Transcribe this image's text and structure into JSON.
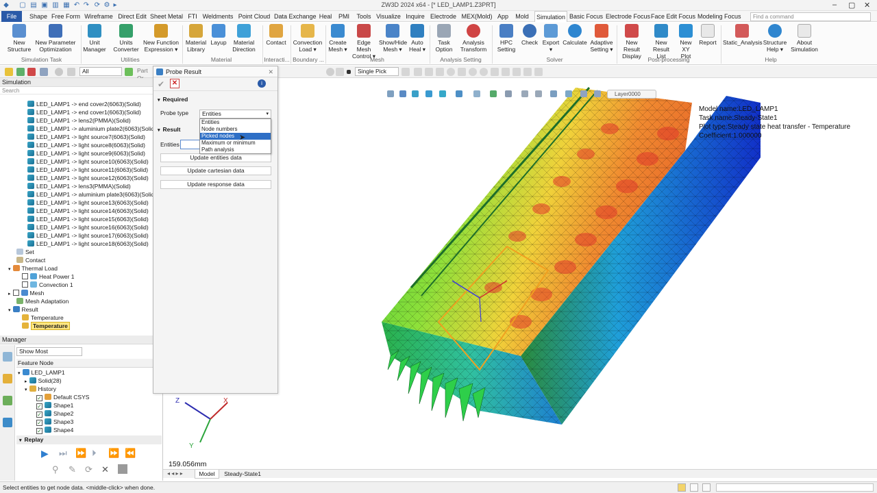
{
  "window": {
    "title": "ZW3D 2024 x64 - [* LED_LAMP1.Z3PRT]"
  },
  "menu": {
    "items": [
      "File",
      "Shape",
      "Free Form",
      "Wireframe",
      "Direct Edit",
      "Sheet Metal",
      "FTI",
      "Weldments",
      "Point Cloud",
      "Data Exchange",
      "Heal",
      "PMI",
      "Tools",
      "Visualize",
      "Inquire",
      "Electrode",
      "MEX(Mold)",
      "App",
      "Mold",
      "Simulation",
      "Basic Focus",
      "Electrode Focus",
      "Face Edit Focus",
      "Modeling Focus"
    ],
    "active": "Simulation",
    "search_placeholder": "Find a command"
  },
  "ribbon": {
    "buttons": [
      {
        "l1": "New",
        "l2": "Structure",
        "icon": "new-structure-icon"
      },
      {
        "l1": "New Parameter",
        "l2": "Optimization",
        "icon": "optimization-icon"
      },
      {
        "l1": "Unit",
        "l2": "Manager",
        "icon": "unit-manager-icon"
      },
      {
        "l1": "Units",
        "l2": "Converter",
        "icon": "units-converter-icon"
      },
      {
        "l1": "New Function",
        "l2": "Expression ▾",
        "icon": "function-icon"
      },
      {
        "l1": "Material",
        "l2": "Library",
        "icon": "material-library-icon"
      },
      {
        "l1": "Layup",
        "l2": "",
        "icon": "layup-icon"
      },
      {
        "l1": "Material",
        "l2": "Direction",
        "icon": "material-direction-icon"
      },
      {
        "l1": "Contact",
        "l2": "",
        "icon": "contact-icon"
      },
      {
        "l1": "Convection",
        "l2": "Load ▾",
        "icon": "convection-icon"
      },
      {
        "l1": "Create",
        "l2": "Mesh ▾",
        "icon": "create-mesh-icon"
      },
      {
        "l1": "Edge Mesh",
        "l2": "Control ▾",
        "icon": "edge-mesh-icon"
      },
      {
        "l1": "Show/Hide",
        "l2": "Mesh ▾",
        "icon": "show-hide-mesh-icon"
      },
      {
        "l1": "Auto",
        "l2": "Heal ▾",
        "icon": "auto-heal-icon"
      },
      {
        "l1": "Task",
        "l2": "Option",
        "icon": "task-option-icon"
      },
      {
        "l1": "Analysis",
        "l2": "Transform",
        "icon": "analysis-transform-icon"
      },
      {
        "l1": "HPC",
        "l2": "Setting",
        "icon": "hpc-icon"
      },
      {
        "l1": "Check",
        "l2": "",
        "icon": "check-icon"
      },
      {
        "l1": "Export",
        "l2": "▾",
        "icon": "export-icon"
      },
      {
        "l1": "Calculate",
        "l2": "",
        "icon": "calculate-icon"
      },
      {
        "l1": "Adaptive",
        "l2": "Setting ▾",
        "icon": "adaptive-icon"
      },
      {
        "l1": "New Result",
        "l2": "Display",
        "icon": "result-display-icon"
      },
      {
        "l1": "New Result",
        "l2": "List",
        "icon": "result-list-icon"
      },
      {
        "l1": "New XY",
        "l2": "Plot",
        "icon": "xy-plot-icon"
      },
      {
        "l1": "Report",
        "l2": "",
        "icon": "report-icon"
      },
      {
        "l1": "Static_Analysis",
        "l2": "",
        "icon": "static-analysis-icon"
      },
      {
        "l1": "Structure",
        "l2": "Help ▾",
        "icon": "help-icon"
      },
      {
        "l1": "About",
        "l2": "Simulation",
        "icon": "about-icon"
      }
    ],
    "groups": [
      "Simulation Task",
      "Utilities",
      "Material",
      "Interacti...",
      "Boundary ...",
      "Mesh",
      "Analysis Setting",
      "Solver",
      "Post-processing",
      "Help"
    ]
  },
  "toolbar": {
    "filter": "All",
    "part_label": "Part Or",
    "pick": "Single Pick"
  },
  "simulation_panel": {
    "title": "Simulation",
    "search": "Search",
    "solids": [
      "LED_LAMP1 -> end cover2(6063)(Solid)",
      "LED_LAMP1 -> end cover1(6063)(Solid)",
      "LED_LAMP1 -> lens2(PMMA)(Solid)",
      "LED_LAMP1 -> aluminium plate2(6063)(Solid)",
      "LED_LAMP1 -> light source7(6063)(Solid)",
      "LED_LAMP1 -> light source8(6063)(Solid)",
      "LED_LAMP1 -> light source9(6063)(Solid)",
      "LED_LAMP1 -> light source10(6063)(Solid)",
      "LED_LAMP1 -> light source11(6063)(Solid)",
      "LED_LAMP1 -> light source12(6063)(Solid)",
      "LED_LAMP1 -> lens3(PMMA)(Solid)",
      "LED_LAMP1 -> aluminium plate3(6063)(Solid)",
      "LED_LAMP1 -> light source13(6063)(Solid)",
      "LED_LAMP1 -> light source14(6063)(Solid)",
      "LED_LAMP1 -> light source15(6063)(Solid)",
      "LED_LAMP1 -> light source16(6063)(Solid)",
      "LED_LAMP1 -> light source17(6063)(Solid)",
      "LED_LAMP1 -> light source18(6063)(Solid)"
    ],
    "set": "Set",
    "contact": "Contact",
    "thermal_load": "Thermal Load",
    "heat_power": "Heat Power 1",
    "convection": "Convection 1",
    "mesh": "Mesh",
    "mesh_adaptation": "Mesh Adaptation",
    "result": "Result",
    "temperature_1": "Temperature",
    "temperature_2": "Temperature"
  },
  "manager": {
    "title": "Manager",
    "filter": "Show Most",
    "column": "Feature Node",
    "nodes": {
      "root": "LED_LAMP1",
      "solid": "Solid(28)",
      "history": "History",
      "csys": "Default CSYS",
      "shapes": [
        "Shape1",
        "Shape2",
        "Shape3",
        "Shape4"
      ]
    },
    "replay": "Replay"
  },
  "probe": {
    "title": "Probe Result",
    "required": "Required",
    "probe_type_label": "Probe type",
    "probe_type_value": "Entities",
    "options": [
      "Entities",
      "Node numbers",
      "Picked nodes",
      "Maximum or minimum",
      "Path analysis"
    ],
    "highlighted_option": "Picked nodes",
    "result": "Result",
    "entities_label": "Entities",
    "buttons": [
      "Update entities data",
      "Update cartesian data",
      "Update response data"
    ]
  },
  "viewport": {
    "layer": "Layer0000",
    "info": {
      "model": "Model name:LED_LAMP1",
      "task": "Task name:Steady-State1",
      "plot": "Plot type:Steady state heat transfer - Temperature",
      "coef": "Coefficient:1.000000"
    },
    "scale": "159.056mm",
    "axes": {
      "x": "X",
      "y": "Y",
      "z": "Z"
    }
  },
  "tabs": {
    "items": [
      "Model",
      "Steady-State1"
    ],
    "active": "Model"
  },
  "status": {
    "text": "Select entities to get node data. <middle-click> when done."
  },
  "colors": {
    "accent": "#2a5aa8",
    "highlight": "#2e6fc6",
    "selected_node": "#ffe680"
  }
}
